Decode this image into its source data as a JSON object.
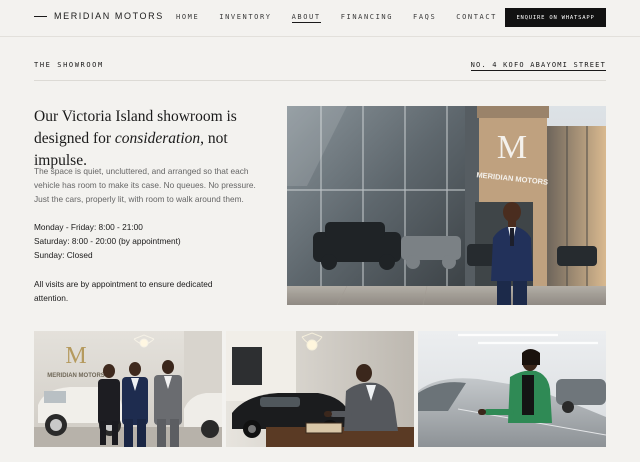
{
  "brand": {
    "name": "MERIDIAN MOTORS"
  },
  "nav": {
    "links": [
      "HOME",
      "INVENTORY",
      "ABOUT",
      "FINANCING",
      "FAQS",
      "CONTACT"
    ],
    "active": "ABOUT",
    "cta_label": "ENQUIRE ON WHATSAPP"
  },
  "section": {
    "label": "THE SHOWROOM",
    "address": "NO. 4 KOFO ABAYOMI STREET"
  },
  "headline": {
    "part1": "Our Victoria Island showroom is designed for ",
    "emphasis": "consideration",
    "part2": ", not impulse."
  },
  "description": "The space is quiet, uncluttered, and arranged so that each vehicle has room to make its case. No queues. No pressure. Just the cars, properly lit, with room to walk around them.",
  "hours": [
    "Monday - Friday: 8:00 - 21:00",
    "Saturday: 8:00 - 20:00 (by appointment)",
    "Sunday: Closed"
  ],
  "note": "All visits are by appointment to ensure dedicated attention.",
  "images": {
    "hero_sign": "MERIDIAN MOTORS",
    "hero_monogram": "M",
    "gallery_sign": "MERIDIAN MOTORS"
  },
  "colors": {
    "background": "#f3f2ef",
    "cta_background": "#121212",
    "text": "#1a1a1a",
    "muted_text": "#666666"
  }
}
